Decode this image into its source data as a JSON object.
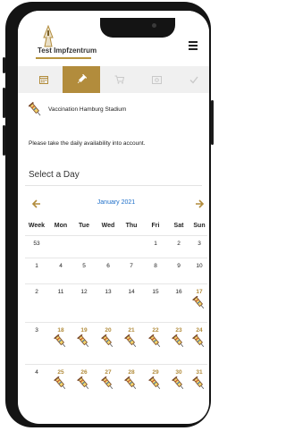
{
  "app": {
    "title": "Test Impfzentrum",
    "accent_color": "#b28c3c",
    "link_color": "#1e6fc9"
  },
  "steps": [
    {
      "icon": "calendar-icon",
      "active": false
    },
    {
      "icon": "syringe-icon",
      "active": true
    },
    {
      "icon": "cart-icon",
      "active": false
    },
    {
      "icon": "payment-icon",
      "active": false
    },
    {
      "icon": "checkmark-icon",
      "active": false
    }
  ],
  "site": {
    "name": "Vaccination Hamburg Stadium"
  },
  "notice": "Please take the daily availability into account.",
  "select_day_label": "Select a Day",
  "calendar": {
    "month_label": "January 2021",
    "headers": [
      "Week",
      "Mon",
      "Tue",
      "Wed",
      "Thu",
      "Fri",
      "Sat",
      "Sun"
    ],
    "weeks": [
      {
        "week": "53",
        "days": [
          "",
          "",
          "",
          "",
          "1",
          "2",
          "3"
        ],
        "available": [
          false,
          false,
          false,
          false,
          false,
          false,
          false
        ]
      },
      {
        "week": "1",
        "days": [
          "4",
          "5",
          "6",
          "7",
          "8",
          "9",
          "10"
        ],
        "available": [
          false,
          false,
          false,
          false,
          false,
          false,
          false
        ]
      },
      {
        "week": "2",
        "days": [
          "11",
          "12",
          "13",
          "14",
          "15",
          "16",
          "17"
        ],
        "available": [
          false,
          false,
          false,
          false,
          false,
          false,
          true
        ]
      },
      {
        "week": "3",
        "days": [
          "18",
          "19",
          "20",
          "21",
          "22",
          "23",
          "24"
        ],
        "available": [
          true,
          true,
          true,
          true,
          true,
          true,
          true
        ]
      },
      {
        "week": "4",
        "days": [
          "25",
          "26",
          "27",
          "28",
          "29",
          "30",
          "31"
        ],
        "available": [
          true,
          true,
          true,
          true,
          true,
          true,
          true
        ]
      }
    ]
  }
}
